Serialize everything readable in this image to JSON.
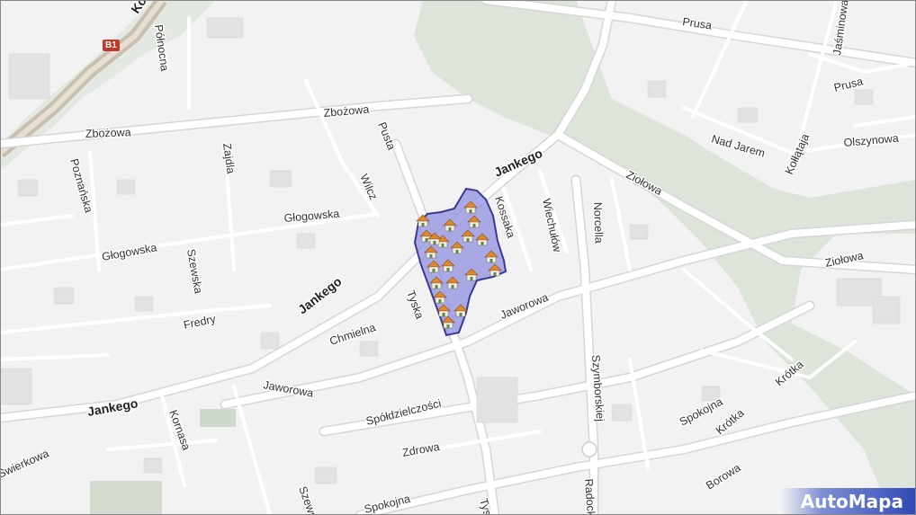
{
  "map": {
    "road_badge": "B1",
    "logo_text": "AutoMapa",
    "colors": {
      "background": "#f2f2f2",
      "road": "#ffffff",
      "road_outline": "#d6d6d6",
      "green": "#cfd8cc",
      "railway": "#c8bfae",
      "area_fill": "#8f8fe0",
      "area_stroke": "#3a3a90",
      "house_roof": "#e0892c",
      "house_body": "#f6f0dc"
    },
    "streets": [
      "Prusa",
      "Prusa",
      "Jaśminowa",
      "Północna",
      "Zbożowa",
      "Zbożowa",
      "Pusta",
      "Zajdla",
      "Poznańska",
      "Jankego",
      "Wilcz",
      "Głogowska",
      "Głogowska",
      "Kossaka",
      "Wiechułów",
      "Norcella",
      "Ziołowa",
      "Nad Jarem",
      "Kołłątaja",
      "Olszynowa",
      "Ziołowa",
      "Szewska",
      "Jankego",
      "Fredry",
      "Chmielna",
      "Tyska",
      "Jaworowa",
      "Jaworowa",
      "Jankego",
      "Szymborskiej",
      "Spółdzielczości",
      "Kornasa",
      "Spokojna",
      "Krótka",
      "Krótka",
      "Zdrowa",
      "Świerkowa",
      "Borowa",
      "Szewska",
      "Spokojna",
      "Radock",
      "Tys",
      "Ko"
    ],
    "icons": [
      "house-icon",
      "b1-road-badge"
    ]
  }
}
